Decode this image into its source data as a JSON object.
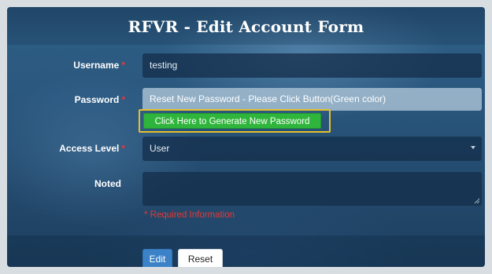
{
  "form": {
    "title": "RFVR - Edit Account Form",
    "required_marker": "*",
    "fields": {
      "username": {
        "label": "Username",
        "value": "testing"
      },
      "password": {
        "label": "Password",
        "value": "Reset New Password - Please Click Button(Green color)"
      },
      "access_level": {
        "label": "Access Level",
        "value": "User"
      },
      "noted": {
        "label": "Noted",
        "value": ""
      }
    },
    "generate_button_label": "Click Here to Generate New Password",
    "required_note": "* Required Information",
    "buttons": {
      "edit": "Edit",
      "reset": "Reset"
    }
  },
  "colors": {
    "required": "#e53935",
    "generate_button": "#2fb53c",
    "highlight_box": "#e6c02a",
    "edit_button": "#3b82c8"
  },
  "icons": {
    "select_caret": "chevron-down-icon",
    "textarea_resize": "resize-handle-icon"
  }
}
